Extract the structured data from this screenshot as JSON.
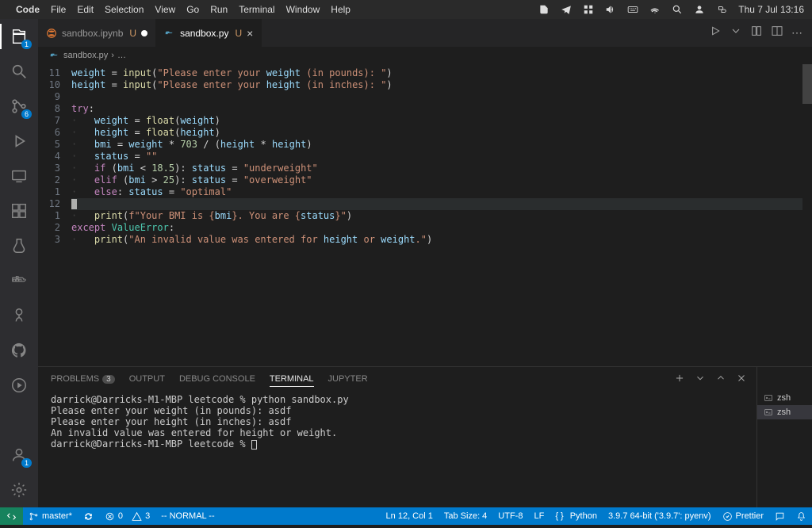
{
  "menubar": {
    "app": "Code",
    "items": [
      "File",
      "Edit",
      "Selection",
      "View",
      "Go",
      "Run",
      "Terminal",
      "Window",
      "Help"
    ],
    "clock": "Thu 7 Jul  13:16"
  },
  "activitybar": {
    "explorer_badge": "1",
    "scm_badge": "6",
    "accounts_badge": "1"
  },
  "tabs": [
    {
      "name": "sandbox.ipynb",
      "mod": "U",
      "dirty": true,
      "active": false
    },
    {
      "name": "sandbox.py",
      "mod": "U",
      "dirty": false,
      "active": true
    }
  ],
  "breadcrumb": {
    "file": "sandbox.py",
    "sep": "›",
    "rest": "…"
  },
  "gutter_nums": [
    "11",
    "10",
    "9",
    "8",
    "7",
    "6",
    "5",
    "4",
    "3",
    "2",
    "1",
    "12",
    "1",
    "2",
    "3"
  ],
  "code_lines": [
    {
      "t": "weight = input(\"Please enter your weight (in pounds): \")",
      "kind": "assign-input"
    },
    {
      "t": "height = input(\"Please enter your height (in inches): \")",
      "kind": "assign-input"
    },
    {
      "t": "",
      "kind": "blank"
    },
    {
      "t": "try:",
      "kind": "try"
    },
    {
      "t": "    weight = float(weight)",
      "kind": "float"
    },
    {
      "t": "    height = float(height)",
      "kind": "float"
    },
    {
      "t": "    bmi = weight * 703 / (height * height)",
      "kind": "calc"
    },
    {
      "t": "    status = \"\"",
      "kind": "assign-str"
    },
    {
      "t": "    if (bmi < 18.5): status = \"underweight\"",
      "kind": "if"
    },
    {
      "t": "    elif (bmi > 25): status = \"overweight\"",
      "kind": "elif"
    },
    {
      "t": "    else: status = \"optimal\"",
      "kind": "else"
    },
    {
      "t": "    ",
      "kind": "cursor"
    },
    {
      "t": "    print(f\"Your BMI is {bmi}. You are {status}\")",
      "kind": "printf"
    },
    {
      "t": "except ValueError:",
      "kind": "except"
    },
    {
      "t": "    print(\"An invalid value was entered for height or weight.\")",
      "kind": "print"
    }
  ],
  "panel": {
    "tabs": {
      "problems": "PROBLEMS",
      "problems_badge": "3",
      "output": "OUTPUT",
      "debug": "DEBUG CONSOLE",
      "terminal": "TERMINAL",
      "jupyter": "JUPYTER"
    },
    "terminal_lines": [
      "darrick@Darricks-M1-MBP leetcode % python sandbox.py",
      "Please enter your weight (in pounds): asdf",
      "Please enter your height (in inches): asdf",
      "An invalid value was entered for height or weight.",
      "darrick@Darricks-M1-MBP leetcode % "
    ],
    "shells": [
      "zsh",
      "zsh"
    ]
  },
  "statusbar": {
    "branch": "master*",
    "sync": "",
    "errors": "0",
    "warnings": "3",
    "mode": "-- NORMAL --",
    "lncol": "Ln 12, Col 1",
    "tab": "Tab Size: 4",
    "enc": "UTF-8",
    "eol": "LF",
    "lang": "Python",
    "interp": "3.9.7 64-bit ('3.9.7': pyenv)",
    "prettier": "Prettier"
  }
}
